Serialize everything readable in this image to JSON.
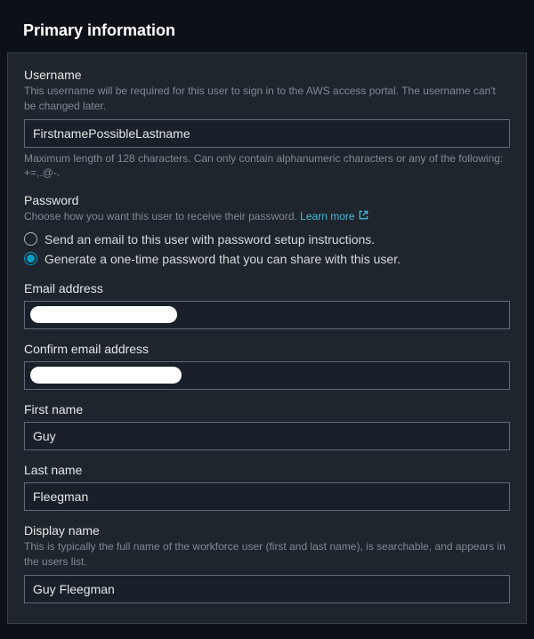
{
  "header": {
    "title": "Primary information"
  },
  "username": {
    "label": "Username",
    "desc": "This username will be required for this user to sign in to the AWS access portal. The username can't be changed later.",
    "value": "FirstnamePossibleLastname",
    "help": "Maximum length of 128 characters. Can only contain alphanumeric characters or any of the following: +=,.@-."
  },
  "password": {
    "label": "Password",
    "desc": "Choose how you want this user to receive their password.",
    "learn_more": "Learn more",
    "option_email": "Send an email to this user with password setup instructions.",
    "option_generate": "Generate a one-time password that you can share with this user."
  },
  "email": {
    "label": "Email address"
  },
  "confirm_email": {
    "label": "Confirm email address"
  },
  "first_name": {
    "label": "First name",
    "value": "Guy"
  },
  "last_name": {
    "label": "Last name",
    "value": "Fleegman"
  },
  "display_name": {
    "label": "Display name",
    "desc": "This is typically the full name of the workforce user (first and last name), is searchable, and appears in the users list.",
    "value": "Guy Fleegman"
  }
}
